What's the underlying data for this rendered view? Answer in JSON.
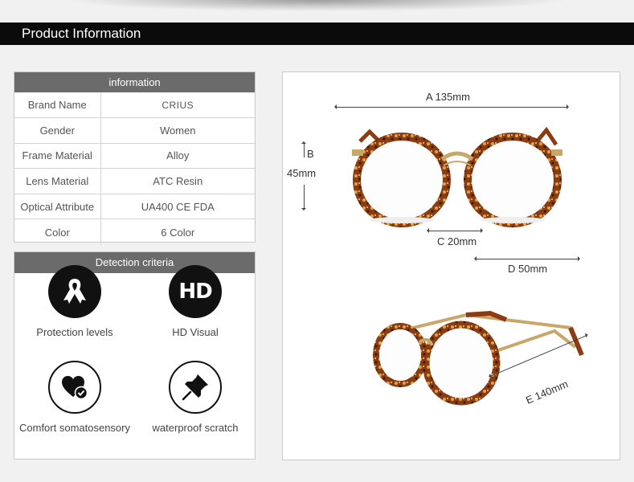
{
  "header": {
    "title": "Product Information"
  },
  "info": {
    "title": "information",
    "rows": [
      {
        "key": "Brand Name",
        "value": "CRIUS"
      },
      {
        "key": "Gender",
        "value": "Women"
      },
      {
        "key": "Frame Material",
        "value": "Alloy"
      },
      {
        "key": "Lens Material",
        "value": "ATC Resin"
      },
      {
        "key": "Optical Attribute",
        "value": "UA400 CE FDA"
      },
      {
        "key": "Color",
        "value": "6 Color"
      }
    ]
  },
  "detection": {
    "title": "Detection criteria",
    "items": [
      {
        "label": "Protection levels",
        "icon": "ribbon-icon"
      },
      {
        "label": "HD Visual",
        "icon": "hd-icon",
        "icon_text": "HD"
      },
      {
        "label": "Comfort somatosensory",
        "icon": "heart-check-icon"
      },
      {
        "label": "waterproof scratch",
        "icon": "pushpin-icon"
      }
    ]
  },
  "dimensions": {
    "a": "A 135mm",
    "b_letter": "B",
    "b_value": "45mm",
    "c": "C 20mm",
    "d": "D 50mm",
    "e": "E 140mm"
  },
  "colors": {
    "tortoise": "#8a3c12",
    "gold": "#c9a76b"
  }
}
